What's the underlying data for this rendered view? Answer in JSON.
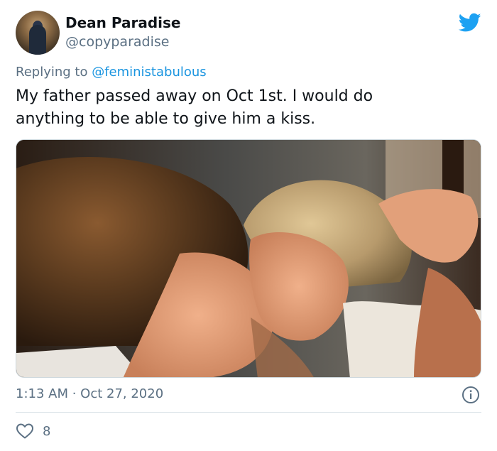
{
  "tweet": {
    "author_name": "Dean Paradise",
    "author_handle": "@copyparadise",
    "replying_prefix": "Replying to ",
    "replying_handle": "@feministabulous",
    "text": "My father passed away on Oct 1st. I would do anything to be able to give him a kiss.",
    "timestamp": "1:13 AM · Oct 27, 2020",
    "like_count": "8"
  },
  "icons": {
    "brand": "twitter-bird-icon",
    "info": "info-icon",
    "like": "heart-icon"
  },
  "colors": {
    "brand": "#1da1f2",
    "mention": "#1b95e0",
    "secondary_text": "#5b7083",
    "primary_text": "#0f1419"
  }
}
